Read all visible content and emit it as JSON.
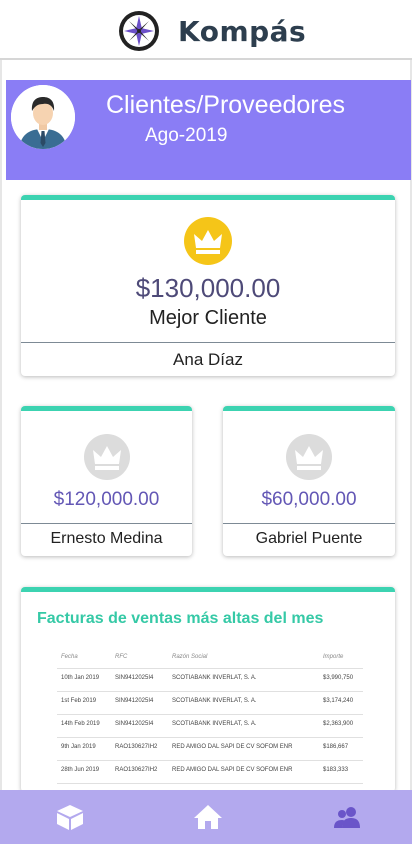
{
  "app": {
    "title": "Kompás",
    "logo_icon": "compass-icon"
  },
  "profile": {
    "title": "Clientes/Proveedores",
    "period": "Ago-2019",
    "avatar_icon": "businessman-avatar"
  },
  "best_client": {
    "amount": "$130,000.00",
    "caption": "Mejor Cliente",
    "name": "Ana Díaz",
    "icon": "crown-icon",
    "icon_color": "#f5c518"
  },
  "second_client": {
    "amount": "$120,000.00",
    "name": "Ernesto Medina",
    "icon": "crown-icon"
  },
  "third_client": {
    "amount": "$60,000.00",
    "name": "Gabriel Puente",
    "icon": "crown-icon"
  },
  "invoices": {
    "title": "Facturas de ventas más altas del mes",
    "columns": [
      "Fecha",
      "RFC",
      "Razón Social",
      "Importe"
    ],
    "rows": [
      [
        "10th Jan 2019",
        "SIN9412025I4",
        "SCOTIABANK INVERLAT, S. A.",
        "$3,990,750"
      ],
      [
        "1st Feb 2019",
        "SIN9412025I4",
        "SCOTIABANK INVERLAT, S. A.",
        "$3,174,240"
      ],
      [
        "14th Feb 2019",
        "SIN9412025I4",
        "SCOTIABANK INVERLAT, S. A.",
        "$2,363,900"
      ],
      [
        "9th Jan 2019",
        "RAO130627IH2",
        "RED AMIGO DAL SAPI DE CV SOFOM ENR",
        "$186,667"
      ],
      [
        "28th Jun 2019",
        "RAO130627IH2",
        "RED AMIGO DAL SAPI DE CV SOFOM ENR",
        "$183,333"
      ]
    ]
  },
  "nav": {
    "products_icon": "cube-icon",
    "home_icon": "home-icon",
    "clients_icon": "users-icon"
  },
  "colors": {
    "accent": "#8a7df5",
    "teal": "#3cd3b1",
    "nav": "#b3a9ee",
    "gold": "#f5c518"
  }
}
